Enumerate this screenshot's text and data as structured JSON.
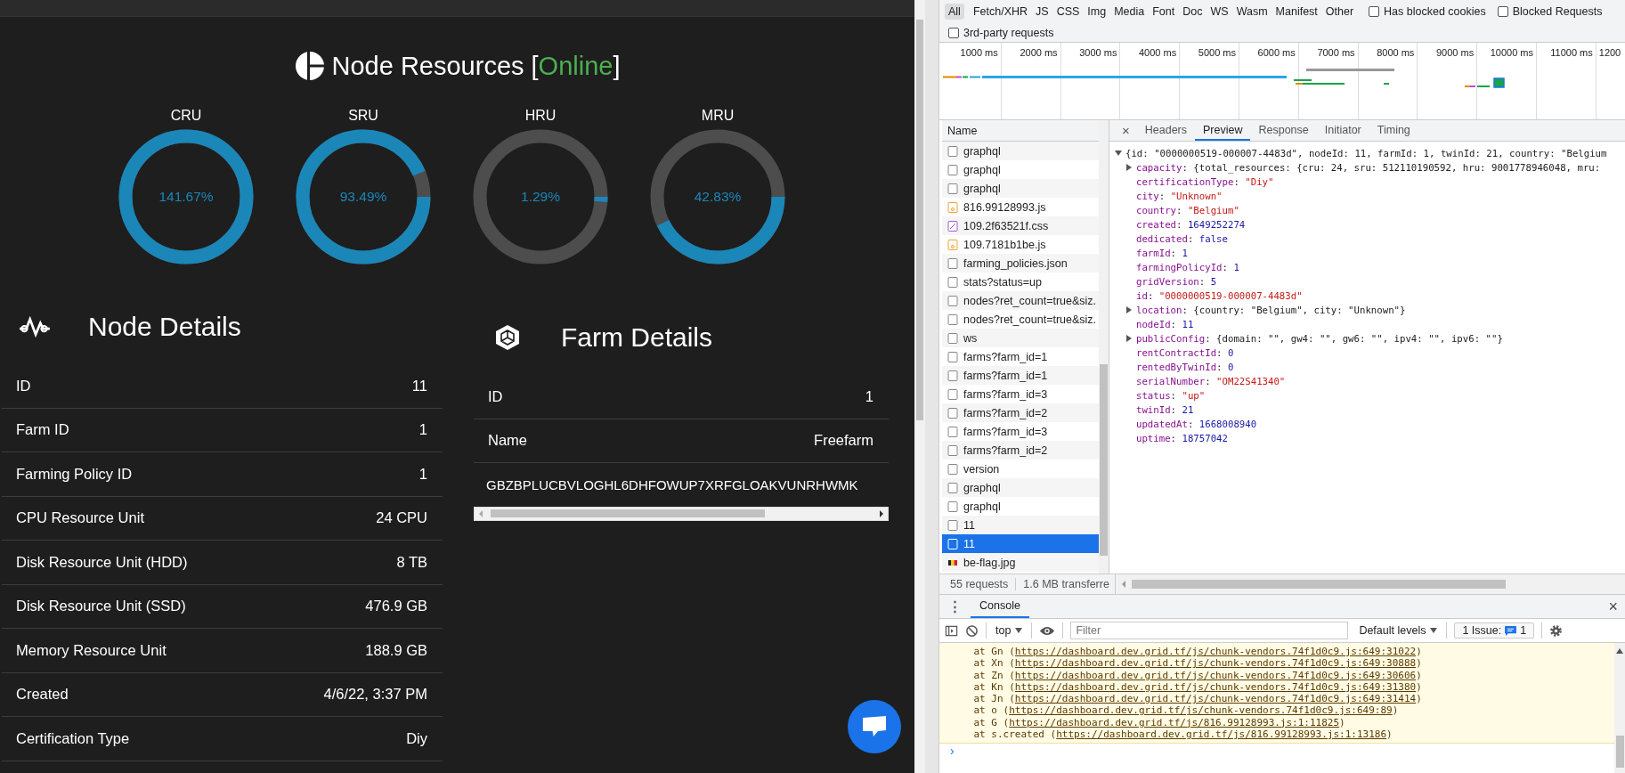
{
  "resources": {
    "title": "Node Resources",
    "status": {
      "open": "[",
      "text": "Online",
      "close": "]"
    },
    "gauges": [
      {
        "label": "CRU",
        "reading": "141.67%",
        "level": 1
      },
      {
        "label": "SRU",
        "reading": "93.49%",
        "level": 0.9349
      },
      {
        "label": "HRU",
        "reading": "1.29%",
        "level": 0.0129
      },
      {
        "label": "MRU",
        "reading": "42.83%",
        "level": 0.4283
      }
    ]
  },
  "node_details": {
    "title": "Node Details",
    "rows": [
      {
        "label": "ID",
        "value": "11"
      },
      {
        "label": "Farm ID",
        "value": "1"
      },
      {
        "label": "Farming Policy ID",
        "value": "1"
      },
      {
        "label": "CPU Resource Unit",
        "value": "24 CPU"
      },
      {
        "label": "Disk Resource Unit (HDD)",
        "value": "8 TB"
      },
      {
        "label": "Disk Resource Unit (SSD)",
        "value": "476.9 GB"
      },
      {
        "label": "Memory Resource Unit",
        "value": "188.9 GB"
      },
      {
        "label": "Created",
        "value": "4/6/22, 3:37 PM"
      },
      {
        "label": "Certification Type",
        "value": "Diy"
      }
    ]
  },
  "farm_details": {
    "title": "Farm Details",
    "rows": [
      {
        "label": "ID",
        "value": "1"
      },
      {
        "label": "Name",
        "value": "Freefarm"
      }
    ],
    "address": "GBZBPLUCBVLOGHL6DHFOWUP7XRFGLOAKVUNRHWMK"
  },
  "devtools": {
    "filters": [
      {
        "label": "All",
        "selected": true
      },
      {
        "label": "Fetch/XHR",
        "selected": false
      },
      {
        "label": "JS",
        "selected": false
      },
      {
        "label": "CSS",
        "selected": false
      },
      {
        "label": "Img",
        "selected": false
      },
      {
        "label": "Media",
        "selected": false
      },
      {
        "label": "Font",
        "selected": false
      },
      {
        "label": "Doc",
        "selected": false
      },
      {
        "label": "WS",
        "selected": false
      },
      {
        "label": "Wasm",
        "selected": false
      },
      {
        "label": "Manifest",
        "selected": false
      },
      {
        "label": "Other",
        "selected": false
      }
    ],
    "checkboxes": [
      {
        "label": "Has blocked cookies",
        "checked": false
      },
      {
        "label": "Blocked Requests",
        "checked": false
      },
      {
        "label": "3rd-party requests",
        "checked": false
      }
    ],
    "timeline": {
      "ticks": [
        "1000 ms",
        "2000 ms",
        "3000 ms",
        "4000 ms",
        "5000 ms",
        "6000 ms",
        "7000 ms",
        "8000 ms",
        "9000 ms",
        "10000 ms",
        "11000 ms",
        "1200"
      ]
    },
    "requests": {
      "header": "Name",
      "items": [
        {
          "name": "graphql",
          "kind": "doc",
          "selected": false
        },
        {
          "name": "graphql",
          "kind": "doc",
          "selected": false
        },
        {
          "name": "graphql",
          "kind": "doc",
          "selected": false
        },
        {
          "name": "816.99128993.js",
          "kind": "script",
          "selected": false
        },
        {
          "name": "109.2f63521f.css",
          "kind": "style",
          "selected": false
        },
        {
          "name": "109.7181b1be.js",
          "kind": "script",
          "selected": false
        },
        {
          "name": "farming_policies.json",
          "kind": "doc",
          "selected": false
        },
        {
          "name": "stats?status=up",
          "kind": "doc",
          "selected": false
        },
        {
          "name": "nodes?ret_count=true&siz.",
          "kind": "doc",
          "selected": false
        },
        {
          "name": "nodes?ret_count=true&siz.",
          "kind": "doc",
          "selected": false
        },
        {
          "name": "ws",
          "kind": "doc",
          "selected": false
        },
        {
          "name": "farms?farm_id=1",
          "kind": "doc",
          "selected": false
        },
        {
          "name": "farms?farm_id=1",
          "kind": "doc",
          "selected": false
        },
        {
          "name": "farms?farm_id=3",
          "kind": "doc",
          "selected": false
        },
        {
          "name": "farms?farm_id=2",
          "kind": "doc",
          "selected": false
        },
        {
          "name": "farms?farm_id=3",
          "kind": "doc",
          "selected": false
        },
        {
          "name": "farms?farm_id=2",
          "kind": "doc",
          "selected": false
        },
        {
          "name": "version",
          "kind": "doc",
          "selected": false
        },
        {
          "name": "graphql",
          "kind": "doc",
          "selected": false
        },
        {
          "name": "graphql",
          "kind": "doc",
          "selected": false
        },
        {
          "name": "11",
          "kind": "doc",
          "selected": false
        },
        {
          "name": "11",
          "kind": "doc",
          "selected": true
        },
        {
          "name": "be-flag.jpg",
          "kind": "image",
          "selected": false
        }
      ],
      "count": "55 requests",
      "transferred": "1.6 MB transferre"
    },
    "detail_close": "×",
    "detail_tabs": [
      {
        "label": "Headers",
        "selected": false
      },
      {
        "label": "Preview",
        "selected": true
      },
      {
        "label": "Response",
        "selected": false
      },
      {
        "label": "Initiator",
        "selected": false
      },
      {
        "label": "Timing",
        "selected": false
      }
    ],
    "preview": {
      "separator": ": ",
      "root": {
        "summary": "{id: \"0000000519-000007-4483d\", nodeId: 11, farmId: 1, twinId: 21, country: \"Belgium",
        "expanded": true
      },
      "props": [
        {
          "key": "capacity",
          "value": "{total_resources: {cru: 24, sru: 512110190592, hru: 9001778946048, mru:",
          "kind": "object",
          "expanded": false
        },
        {
          "key": "certificationType",
          "value": "\"Diy\"",
          "kind": "string"
        },
        {
          "key": "city",
          "value": "\"Unknown\"",
          "kind": "string"
        },
        {
          "key": "country",
          "value": "\"Belgium\"",
          "kind": "string"
        },
        {
          "key": "created",
          "value": "1649252274",
          "kind": "number"
        },
        {
          "key": "dedicated",
          "value": "false",
          "kind": "number"
        },
        {
          "key": "farmId",
          "value": "1",
          "kind": "number"
        },
        {
          "key": "farmingPolicyId",
          "value": "1",
          "kind": "number"
        },
        {
          "key": "gridVersion",
          "value": "5",
          "kind": "number"
        },
        {
          "key": "id",
          "value": "\"0000000519-000007-4483d\"",
          "kind": "string"
        },
        {
          "key": "location",
          "value": "{country: \"Belgium\", city: \"Unknown\"}",
          "kind": "object",
          "expanded": false
        },
        {
          "key": "nodeId",
          "value": "11",
          "kind": "number"
        },
        {
          "key": "publicConfig",
          "value": "{domain: \"\", gw4: \"\", gw6: \"\", ipv4: \"\", ipv6: \"\"}",
          "kind": "object",
          "expanded": false
        },
        {
          "key": "rentContractId",
          "value": "0",
          "kind": "number"
        },
        {
          "key": "rentedByTwinId",
          "value": "0",
          "kind": "number"
        },
        {
          "key": "serialNumber",
          "value": "\"OM22S41340\"",
          "kind": "string"
        },
        {
          "key": "status",
          "value": "\"up\"",
          "kind": "string"
        },
        {
          "key": "twinId",
          "value": "21",
          "kind": "number"
        },
        {
          "key": "updatedAt",
          "value": "1668008940",
          "kind": "number"
        },
        {
          "key": "uptime",
          "value": "18757042",
          "kind": "number"
        }
      ]
    },
    "console": {
      "menu": "⋮",
      "tab": "Console",
      "close": "×",
      "context": "top",
      "filter_placeholder": "Filter",
      "levels": "Default levels",
      "issues_label": "1 Issue:",
      "issues_count": "1",
      "prompt": "›",
      "lines": [
        {
          "text": "    at Gn (",
          "link": "https://dashboard.dev.grid.tf/js/chunk-vendors.74f1d0c9.js:649:31022",
          "end": ")"
        },
        {
          "text": "    at Xn (",
          "link": "https://dashboard.dev.grid.tf/js/chunk-vendors.74f1d0c9.js:649:30888",
          "end": ")"
        },
        {
          "text": "    at Zn (",
          "link": "https://dashboard.dev.grid.tf/js/chunk-vendors.74f1d0c9.js:649:30606",
          "end": ")"
        },
        {
          "text": "    at Kn (",
          "link": "https://dashboard.dev.grid.tf/js/chunk-vendors.74f1d0c9.js:649:31380",
          "end": ")"
        },
        {
          "text": "    at Jn (",
          "link": "https://dashboard.dev.grid.tf/js/chunk-vendors.74f1d0c9.js:649:31414",
          "end": ")"
        },
        {
          "text": "    at o (",
          "link": "https://dashboard.dev.grid.tf/js/chunk-vendors.74f1d0c9.js:649:89",
          "end": ")"
        },
        {
          "text": "    at G (",
          "link": "https://dashboard.dev.grid.tf/js/816.99128993.js:1:11825",
          "end": ")"
        },
        {
          "text": "    at s.created (",
          "link": "https://dashboard.dev.grid.tf/js/816.99128993.js:1:13186",
          "end": ")"
        }
      ]
    }
  }
}
